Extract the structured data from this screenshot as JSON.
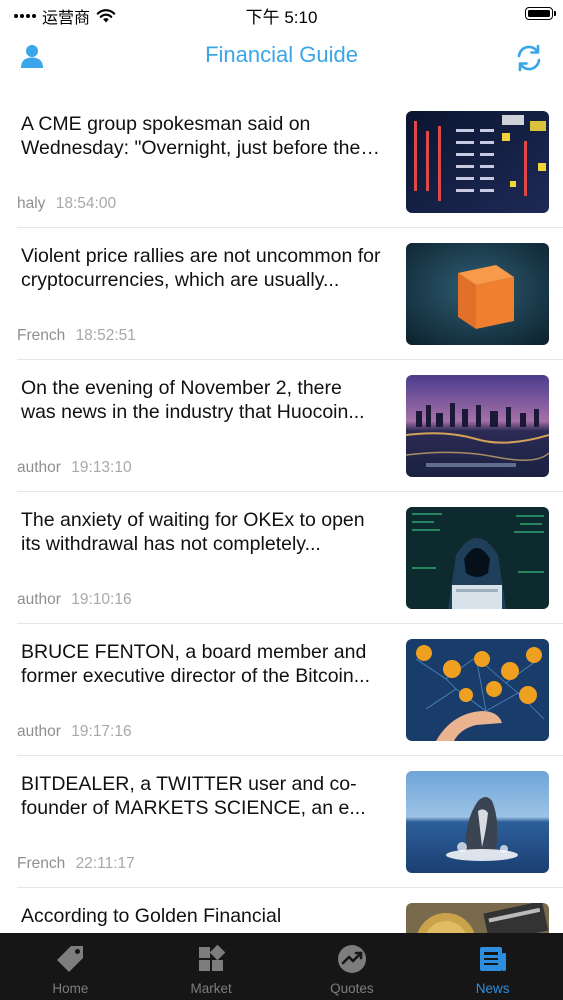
{
  "status_bar": {
    "carrier": "运营商",
    "time": "下午 5:10"
  },
  "nav": {
    "title": "Financial Guide",
    "left_icon": "user-icon",
    "right_icon": "refresh-icon"
  },
  "colors": {
    "accent": "#3aa5e8",
    "tab_active": "#2d8ee0",
    "tab_inactive": "#7d7d7d",
    "tab_bar_bg": "#161616",
    "meta_text": "#9a9a9a"
  },
  "news": [
    {
      "title": "A CME group spokesman said on Wednesday: \"Overnight, just before the market opened...",
      "author": "haly",
      "time": "18:54:00",
      "thumb": "stock-ticker-board-image"
    },
    {
      "title": "Violent price rallies are not uncommon for cryptocurrencies, which are usually...",
      "author": "French",
      "time": "18:52:51",
      "thumb": "orange-cube-image"
    },
    {
      "title": "On the evening of November 2, there was news in the industry that Huocoin...",
      "author": "author",
      "time": "19:13:10",
      "thumb": "city-night-skyline-image"
    },
    {
      "title": "The anxiety of waiting for OKEx to open its withdrawal has not completely...",
      "author": "author",
      "time": "19:10:16",
      "thumb": "hooded-hacker-image"
    },
    {
      "title": "BRUCE FENTON, a board member and former executive director of the Bitcoin...",
      "author": "author",
      "time": "19:17:16",
      "thumb": "bitcoin-network-image"
    },
    {
      "title": "BITDEALER, a TWITTER user and co-founder of MARKETS SCIENCE, an e...",
      "author": "French",
      "time": "22:11:17",
      "thumb": "whale-breaching-image"
    },
    {
      "title": "According to Golden Financial",
      "author": "",
      "time": "",
      "thumb": "bitcoin-coins-image"
    }
  ],
  "tabs": [
    {
      "label": "Home",
      "icon": "tag-icon",
      "active": false
    },
    {
      "label": "Market",
      "icon": "grid-icon",
      "active": false
    },
    {
      "label": "Quotes",
      "icon": "trend-icon",
      "active": false
    },
    {
      "label": "News",
      "icon": "newspaper-icon",
      "active": true
    }
  ]
}
